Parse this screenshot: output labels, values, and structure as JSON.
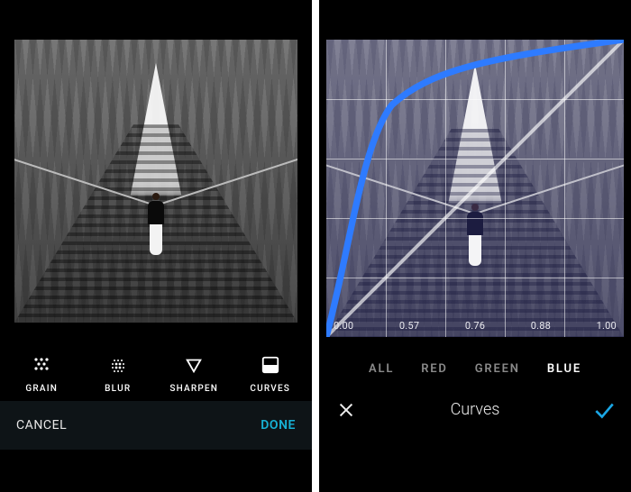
{
  "left": {
    "tools": [
      {
        "id": "grain",
        "label": "GRAIN"
      },
      {
        "id": "blur",
        "label": "BLUR"
      },
      {
        "id": "sharpen",
        "label": "SHARPEN"
      },
      {
        "id": "curves",
        "label": "CURVES"
      }
    ],
    "cancel_label": "CANCEL",
    "done_label": "DONE"
  },
  "right": {
    "title": "Curves",
    "channels": [
      {
        "id": "all",
        "label": "ALL",
        "active": false
      },
      {
        "id": "red",
        "label": "RED",
        "active": false
      },
      {
        "id": "green",
        "label": "GREEN",
        "active": false
      },
      {
        "id": "blue",
        "label": "BLUE",
        "active": true
      }
    ],
    "x_ticks": [
      "0.00",
      "0.57",
      "0.76",
      "0.88",
      "1.00"
    ],
    "accent_color": "#1aa7e6",
    "curve_color": "#2e7bff"
  }
}
